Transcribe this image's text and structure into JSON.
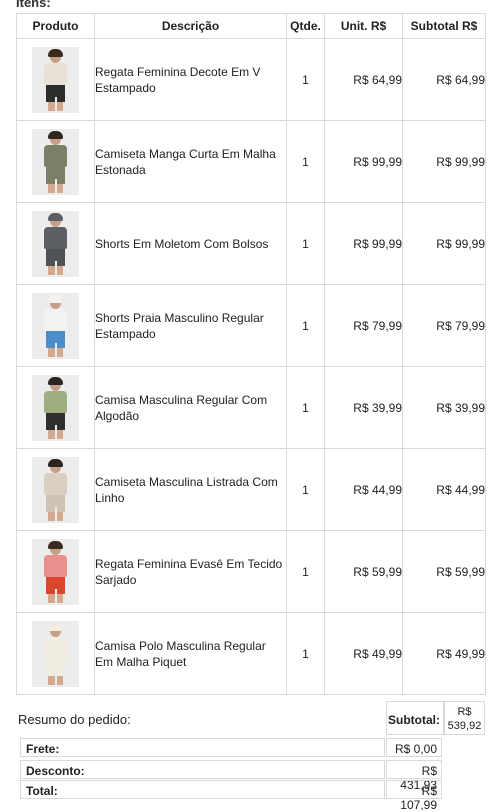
{
  "itens_label": "Itens:",
  "headers": {
    "produto": "Produto",
    "descricao": "Descrição",
    "qtde": "Qtde.",
    "unit": "Unit. R$",
    "subtotal": "Subtotal R$"
  },
  "items": [
    {
      "description": "Regata Feminina Decote Em V Estampado",
      "qty": "1",
      "unit": "R$ 64,99",
      "subtotal": "R$ 64,99",
      "colors": {
        "top": "#e9e1d6",
        "bottom": "#2d2d2d",
        "hair": "#3a2a20"
      }
    },
    {
      "description": "Camiseta Manga Curta Em Malha Estonada",
      "qty": "1",
      "unit": "R$ 99,99",
      "subtotal": "R$ 99,99",
      "colors": {
        "top": "#7d8068",
        "bottom": "#7d8068",
        "hair": "#2e2620"
      }
    },
    {
      "description": "Shorts Em Moletom Com Bolsos",
      "qty": "1",
      "unit": "R$ 99,99",
      "subtotal": "R$ 99,99",
      "colors": {
        "top": "#5c5f63",
        "bottom": "#4f5257",
        "hair": "#5c5f63"
      }
    },
    {
      "description": "Shorts Praia Masculino Regular Estampado",
      "qty": "1",
      "unit": "R$ 79,99",
      "subtotal": "R$ 79,99",
      "colors": {
        "top": "#f2f2f2",
        "bottom": "#4a8fc9",
        "hair": "#f2f2f2"
      }
    },
    {
      "description": "Camisa Masculina Regular Com Algodão",
      "qty": "1",
      "unit": "R$ 39,99",
      "subtotal": "R$ 39,99",
      "colors": {
        "top": "#9fae80",
        "bottom": "#2f2f2f",
        "hair": "#2b241f"
      }
    },
    {
      "description": "Camiseta Masculina Listrada Com Linho",
      "qty": "1",
      "unit": "R$ 44,99",
      "subtotal": "R$ 44,99",
      "colors": {
        "top": "#d8cfc0",
        "bottom": "#cfc4b3",
        "hair": "#2b241f"
      }
    },
    {
      "description": "Regata Feminina Evasê Em Tecido Sarjado",
      "qty": "1",
      "unit": "R$ 59,99",
      "subtotal": "R$ 59,99",
      "colors": {
        "top": "#e9908e",
        "bottom": "#d9472f",
        "hair": "#3a2a20"
      }
    },
    {
      "description": "Camisa Polo Masculina Regular Em Malha Piquet",
      "qty": "1",
      "unit": "R$ 49,99",
      "subtotal": "R$ 49,99",
      "colors": {
        "top": "#f1ede3",
        "bottom": "#f1ede3",
        "hair": "#f1ede3"
      }
    }
  ],
  "summary": {
    "title": "Resumo do pedido:",
    "subtotal_label": "Subtotal:",
    "subtotal_value": "R$ 539,92",
    "frete_label": "Frete:",
    "frete_value": "R$ 0,00",
    "desconto_label": "Desconto:",
    "desconto_value": "R$ 431,93",
    "total_label": "Total:",
    "total_value": "R$ 107,99"
  }
}
